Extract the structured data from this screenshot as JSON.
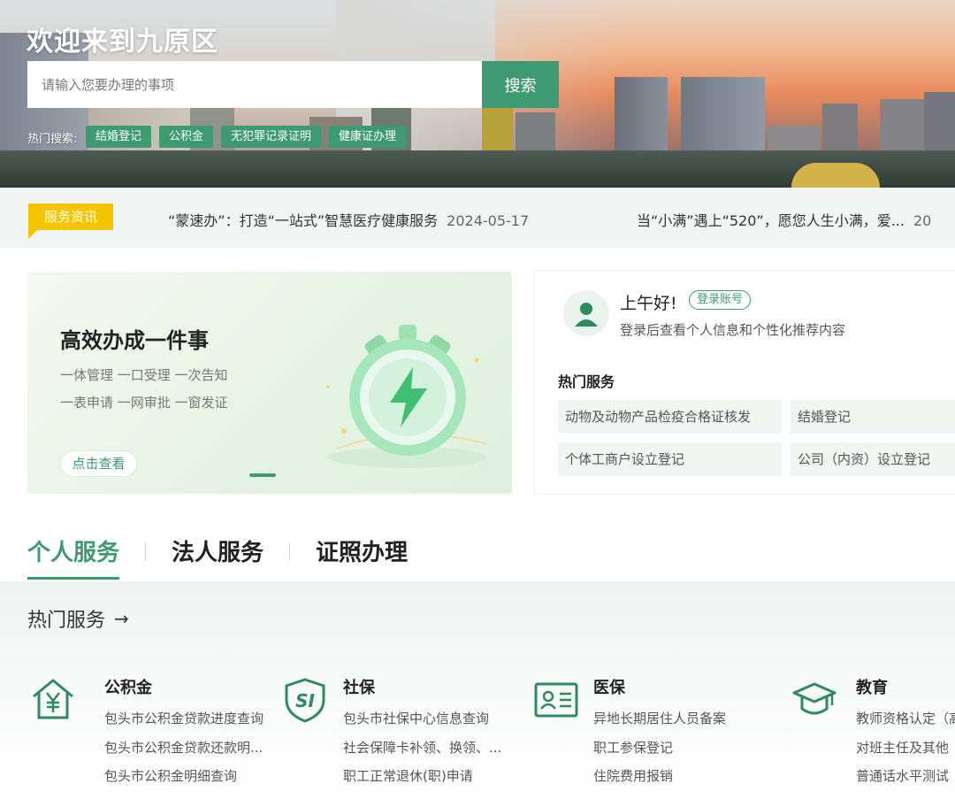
{
  "hero": {
    "title": "欢迎来到九原区",
    "search_placeholder": "请输入您要办理的事项",
    "search_button": "搜索",
    "hot_label": "热门搜索:",
    "hot_tags": [
      "结婚登记",
      "公积金",
      "无犯罪记录证明",
      "健康证办理"
    ]
  },
  "news": {
    "badge": "服务资讯",
    "items": [
      {
        "title": "“蒙速办”：打造“一站式”智慧医疗健康服务",
        "date": "2024-05-17"
      },
      {
        "title": "当“小满”遇上“520”，愿您人生小满，爱...",
        "date": "20"
      }
    ]
  },
  "banner": {
    "title": "高效办成一件事",
    "line1": "一体管理 一口受理 一次告知",
    "line2": "一表申请 一网审批 一窗发证",
    "cta": "点击查看"
  },
  "user": {
    "greeting": "上午好!",
    "login_button": "登录账号",
    "login_tip": "登录后查看个人信息和个性化推荐内容",
    "hot_title": "热门服务",
    "services": [
      "动物及动物产品检疫合格证核发",
      "结婚登记",
      "个体工商户设立登记",
      "公司（内资）设立登记"
    ]
  },
  "tabs": [
    "个人服务",
    "法人服务",
    "证照办理"
  ],
  "section": {
    "title": "热门服务",
    "arrow": "→",
    "categories": [
      {
        "name": "公积金",
        "icon": "housing-fund-icon",
        "links": [
          "包头市公积金贷款进度查询",
          "包头市公积金贷款还款明...",
          "包头市公积金明细查询"
        ]
      },
      {
        "name": "社保",
        "icon": "social-security-icon",
        "links": [
          "包头市社保中心信息查询",
          "社会保障卡补领、换领、...",
          "职工正常退休(职)申请"
        ]
      },
      {
        "name": "医保",
        "icon": "medical-insurance-icon",
        "links": [
          "异地长期居住人员备案",
          "职工参保登记",
          "住院费用报销"
        ]
      },
      {
        "name": "教育",
        "icon": "education-icon",
        "links": [
          "教师资格认定（高",
          "对班主任及其他",
          "普通话水平测试"
        ]
      }
    ]
  },
  "colors": {
    "primary": "#3d9a72",
    "badge": "#f5c400"
  }
}
